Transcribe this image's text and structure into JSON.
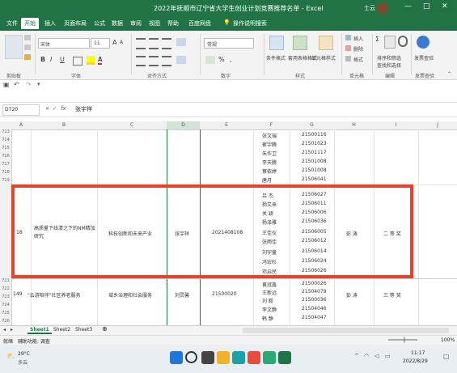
{
  "window": {
    "title": "2022年抚顺市辽宁省大学生创业计划竞赛推荐名单 - Excel",
    "user": "士云",
    "controls": [
      "—",
      "□",
      "✕"
    ]
  },
  "menu": {
    "tabs": [
      "文件",
      "开始",
      "插入",
      "页面布局",
      "公式",
      "数据",
      "审阅",
      "视图",
      "帮助",
      "百度网盘",
      "操作说明搜索"
    ]
  },
  "ribbon": {
    "font_name": "宋体",
    "font_size": "11",
    "bold": "B",
    "italic": "I",
    "underline": "U",
    "number_format": "常规",
    "groups": [
      "剪贴板",
      "字体",
      "对齐方式",
      "数字",
      "样式",
      "单元格",
      "编辑",
      "发票查验"
    ],
    "styles": [
      "条件格式",
      "套用表格格式",
      "单元格样式"
    ],
    "cells": [
      "插入",
      "删除",
      "格式"
    ],
    "edit": [
      "排序和筛选",
      "查找和选择"
    ],
    "invoice": "发票查验"
  },
  "formula": {
    "namebox": "D720",
    "fx": "fx",
    "value": "张宇祥"
  },
  "columns": [
    "A",
    "B",
    "C",
    "D",
    "E",
    "F",
    "G",
    "H",
    "I",
    "J"
  ],
  "rows": {
    "top": [
      "713",
      "714",
      "715",
      "716",
      "717",
      "718",
      "719"
    ],
    "main": "720",
    "bottom": [
      "721",
      "722",
      "723",
      "724",
      "725",
      "726"
    ],
    "next": "728"
  },
  "names_top": [
    "张文瑞",
    "崔宇腾",
    "朱作卫",
    "李天腾",
    "蔡依婷",
    "唐月"
  ],
  "ids_top": [
    "21500116",
    "21501023",
    "21501117",
    "21501008",
    "21501008",
    "21506041"
  ],
  "record": {
    "no": "18",
    "project": "高质量下线清之下的NM精加研究",
    "category": "科技创新和未来产业",
    "leader": "张宇祥",
    "leader_id": "2021408108",
    "advisor": "彭 涛",
    "award": "二 等 奖"
  },
  "members": [
    {
      "name": "吕 杰",
      "id": "21506027"
    },
    {
      "name": "杨又来",
      "id": "21506011"
    },
    {
      "name": "关 颖",
      "id": "21506006"
    },
    {
      "name": "杨泽雅",
      "id": "21506036"
    },
    {
      "name": "王佳仪",
      "id": "21506005"
    },
    {
      "name": "张雨佳",
      "id": "21506012"
    },
    {
      "name": "刘宇童",
      "id": "21506014"
    },
    {
      "name": "冯宏杉",
      "id": "21506024"
    },
    {
      "name": "邓启民",
      "id": "21506026"
    }
  ],
  "record2": {
    "no": "149",
    "project": "\"云游陪伴\"社区养老服务",
    "category": "城乡治理和社会服务",
    "leader": "刘灵馨",
    "leader_id": "21500020",
    "advisor": "彭 涛",
    "award": "三 等 奖"
  },
  "names_bottom": [
    "黄冠鑫",
    "王新远",
    "刘 毅",
    "李文静",
    "韩 静"
  ],
  "ids_bottom": [
    "21500026",
    "21504079",
    "21500036",
    "21504046",
    "21504047"
  ],
  "sheets": [
    "Sheet1",
    "Sheet2",
    "Sheet3"
  ],
  "status": {
    "ready": "就绪",
    "accessibility": "辅助功能: 调查",
    "zoom": "100%"
  },
  "taskbar": {
    "weather_temp": "29°C",
    "weather_desc": "多云",
    "time": "11:17",
    "date": "2022/8/29"
  },
  "colors": {
    "excel_green": "#217346",
    "highlight": "#e8412c"
  }
}
